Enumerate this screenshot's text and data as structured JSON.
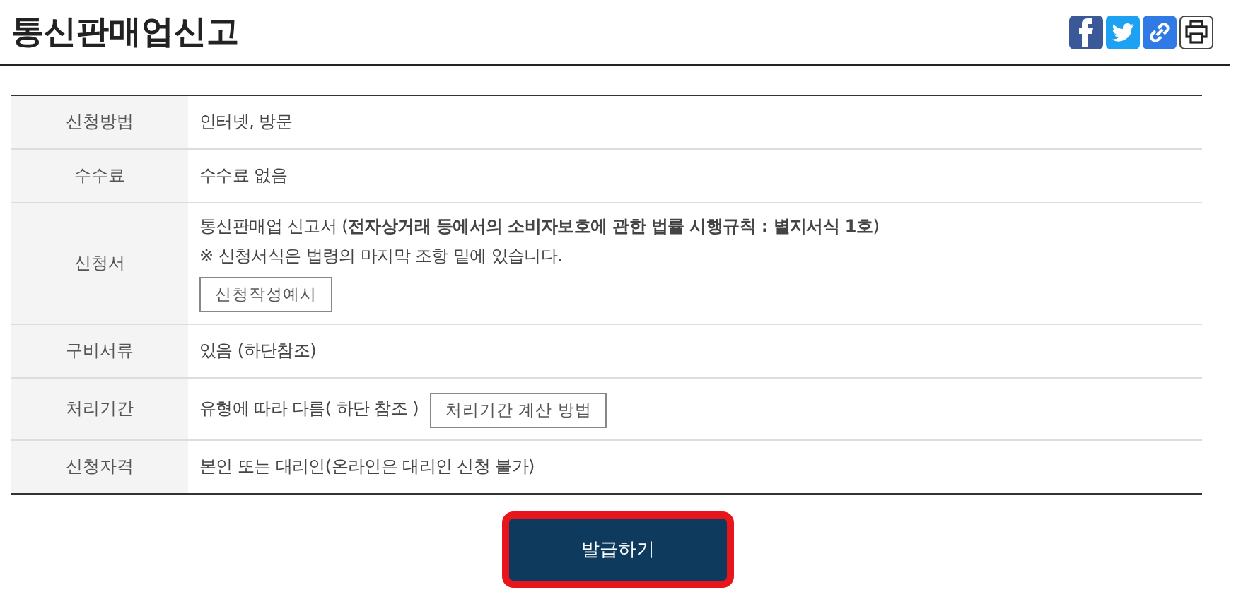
{
  "title": "통신판매업신고",
  "share_icons": [
    {
      "kind": "facebook"
    },
    {
      "kind": "twitter"
    },
    {
      "kind": "link"
    },
    {
      "kind": "print"
    }
  ],
  "rows": [
    {
      "label": "신청방법",
      "lines": [
        [
          {
            "kind": "text",
            "text": "인터넷, 방문"
          }
        ]
      ]
    },
    {
      "label": "수수료",
      "lines": [
        [
          {
            "kind": "text",
            "text": "수수료 없음"
          }
        ]
      ]
    },
    {
      "label": "신청서",
      "lines": [
        [
          {
            "kind": "text",
            "text": "통신판매업 신고서 (**전자상거래 등에서의 소비자보호에 관한 법률 시행규칙 : 별지서식 1호**)"
          }
        ],
        [
          {
            "kind": "text",
            "text": "※ 신청서식은 법령의 마지막 조항 밑에 있습니다."
          }
        ],
        [
          {
            "kind": "button",
            "text": "신청작성예시"
          }
        ]
      ]
    },
    {
      "label": "구비서류",
      "lines": [
        [
          {
            "kind": "text",
            "text": "있음 (하단참조)"
          }
        ]
      ]
    },
    {
      "label": "처리기간",
      "lines": [
        [
          {
            "kind": "text",
            "text": "유형에 따라 다름( 하단 참조 )"
          },
          {
            "kind": "button",
            "text": "처리기간 계산 방법"
          }
        ]
      ]
    },
    {
      "label": "신청자격",
      "lines": [
        [
          {
            "kind": "text",
            "text": "본인 또는 대리인(온라인은 대리인 신청 불가)"
          }
        ]
      ]
    }
  ],
  "submit": {
    "label": "발급하기",
    "highlighted": true
  }
}
